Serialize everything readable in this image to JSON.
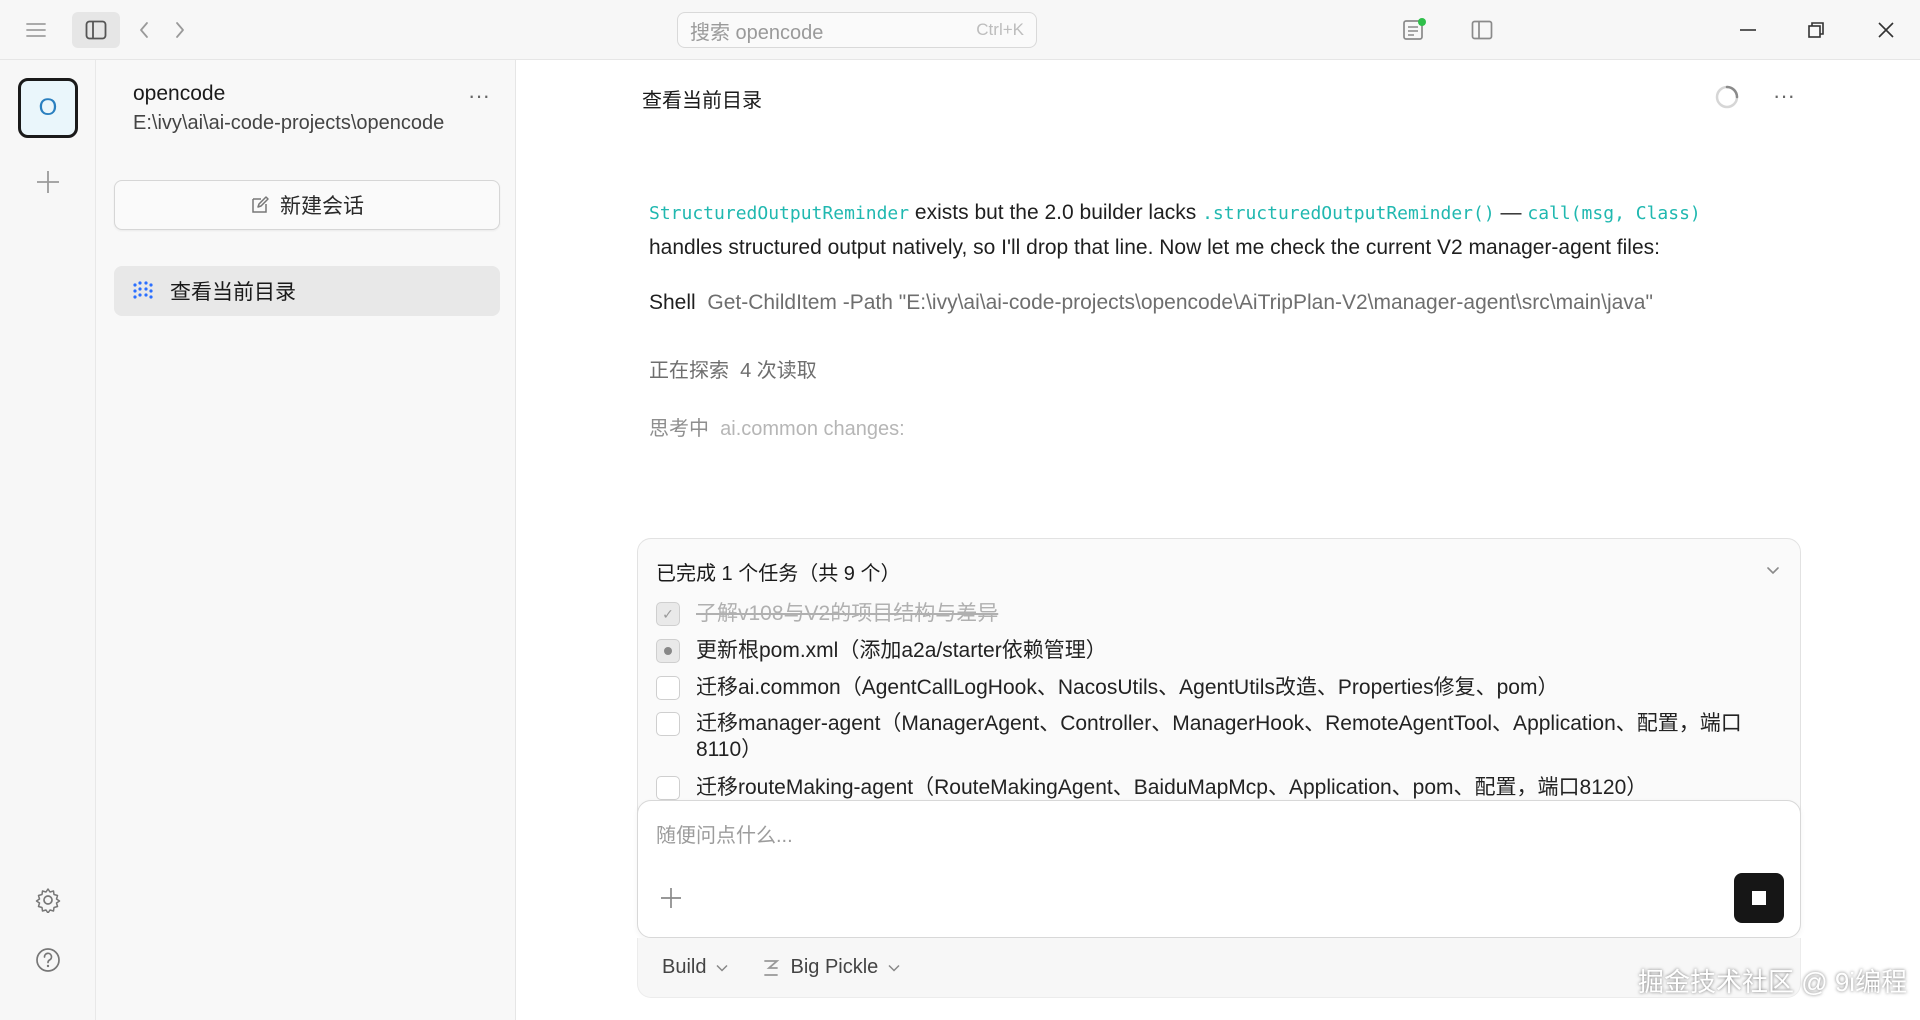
{
  "titlebar": {
    "search_placeholder": "搜索 opencode",
    "search_shortcut": "Ctrl+K"
  },
  "rail": {
    "project_initial": "O"
  },
  "sidebar": {
    "project_name": "opencode",
    "project_path": "E:\\ivy\\ai\\ai-code-projects\\opencode",
    "more_label": "···",
    "new_session_label": "新建会话",
    "sessions": [
      {
        "title": "查看当前目录"
      }
    ]
  },
  "main": {
    "title": "查看当前目录",
    "more_label": "···",
    "message": {
      "code1": "StructuredOutputReminder",
      "text1": " exists but the 2.0 builder lacks ",
      "code2": ".structuredOutputReminder()",
      "text2": " — ",
      "code3": "call(msg, Class)",
      "text3": "handles structured output natively, so I'll drop that line. Now let me check the current V2 manager-agent files:"
    },
    "shell": {
      "label": "Shell",
      "command": "Get-ChildItem -Path \"E:\\ivy\\ai\\ai-code-projects\\opencode\\AiTripPlan-V2\\manager-agent\\src\\main\\java\""
    },
    "exploring": {
      "label": "正在探索",
      "detail": "4 次读取"
    },
    "thinking": {
      "label": "思考中",
      "detail": "ai.common changes:"
    }
  },
  "tasks": {
    "header": "已完成 1 个任务（共 9 个）",
    "items": [
      {
        "text": "了解v108与V2的项目结构与差异",
        "status": "done"
      },
      {
        "text": "更新根pom.xml（添加a2a/starter依赖管理）",
        "status": "in_progress"
      },
      {
        "text": "迁移ai.common（AgentCallLogHook、NacosUtils、AgentUtils改造、Properties修复、pom）",
        "status": "pending"
      },
      {
        "text": "迁移manager-agent（ManagerAgent、Controller、ManagerHook、RemoteAgentTool、Application、配置，端口8110）",
        "status": "pending"
      },
      {
        "text": "迁移routeMaking-agent（RouteMakingAgent、BaiduMapMcp、Application、pom、配置，端口8120）",
        "status": "pending"
      }
    ]
  },
  "composer": {
    "placeholder": "随便问点什么...",
    "mode": "Build",
    "model": "Big Pickle"
  },
  "watermark": "掘金技术社区 @ 9i编程"
}
